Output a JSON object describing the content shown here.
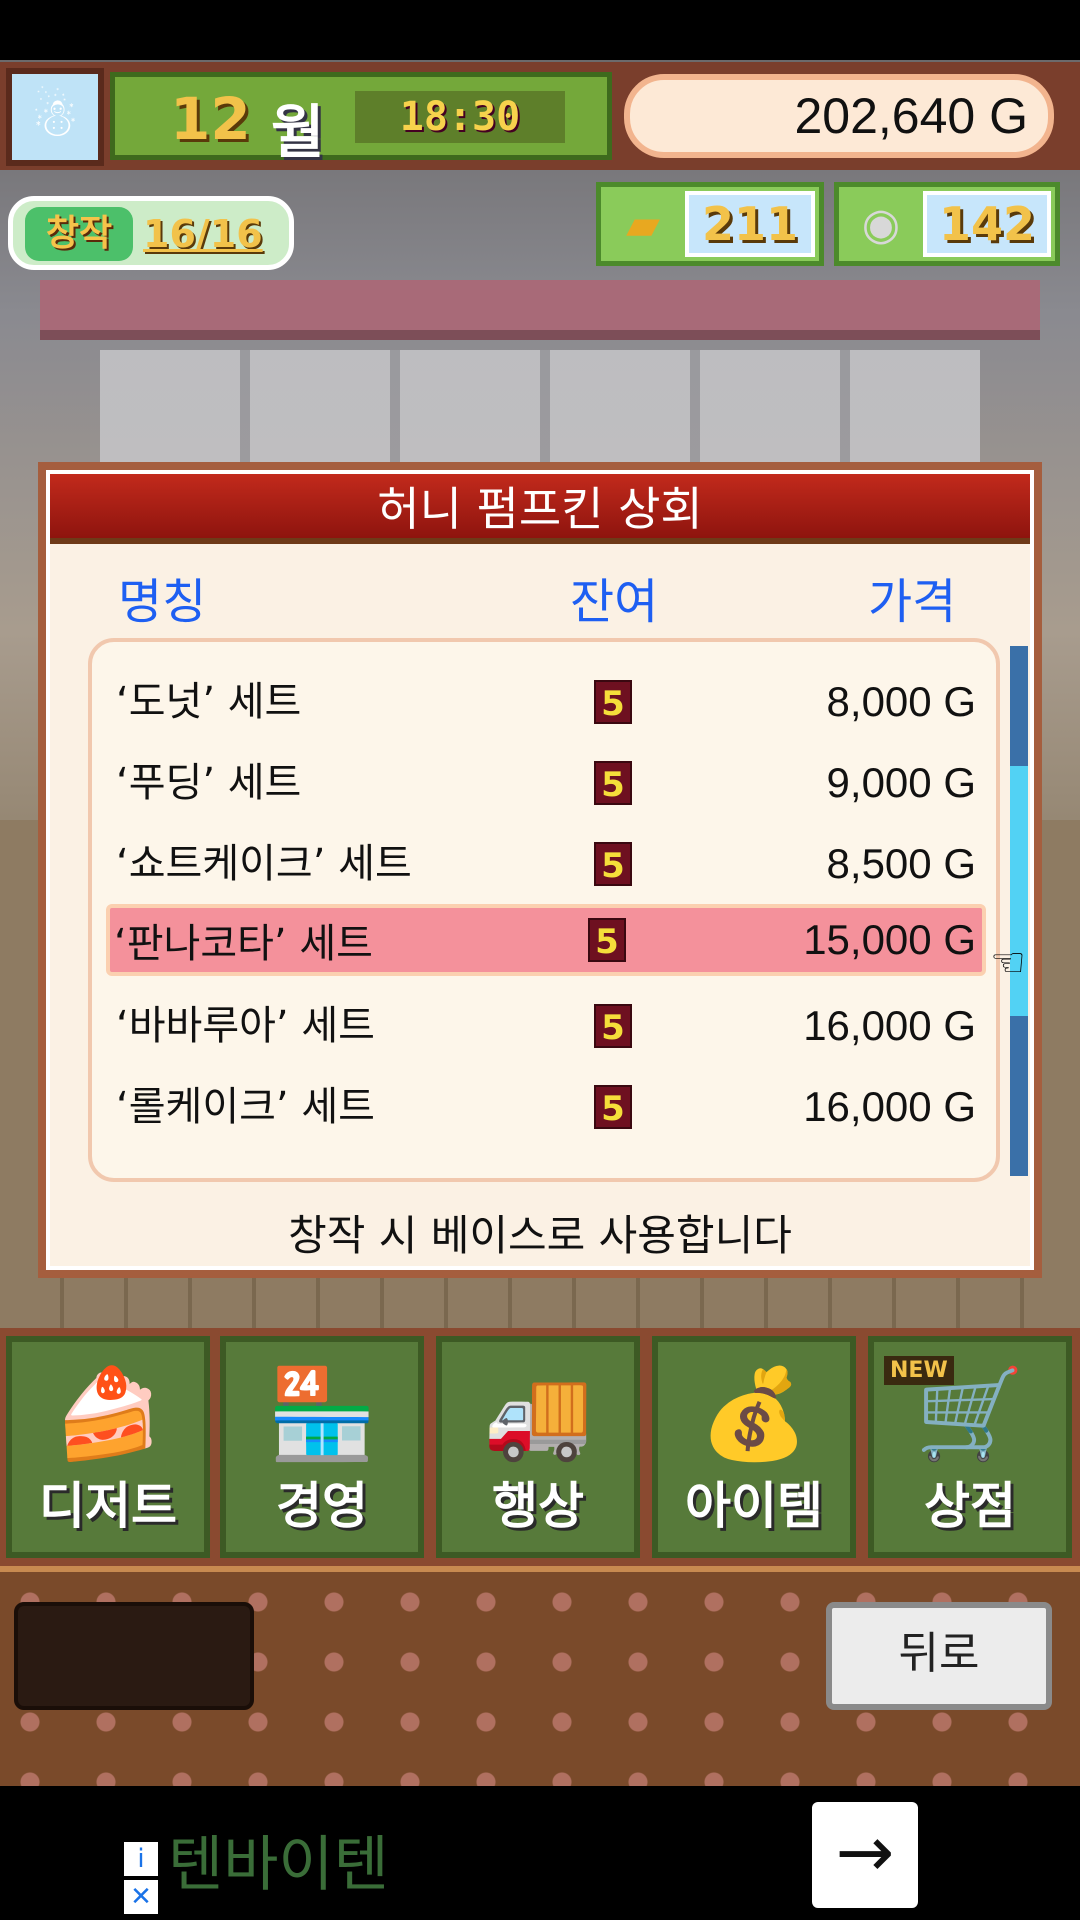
{
  "top": {
    "month_value": "12",
    "month_label": "월",
    "time": "18:30",
    "gold": "202,640 G"
  },
  "creation": {
    "label": "창작",
    "value": "16/16"
  },
  "currency": [
    {
      "icon": "ticket-icon",
      "value": "211"
    },
    {
      "icon": "medal-icon",
      "value": "142"
    }
  ],
  "dialog": {
    "title": "허니 펌프킨 상회",
    "col_name": "명칭",
    "col_stock": "잔여",
    "col_price": "가격",
    "items": [
      {
        "name": "‘도넛’ 세트",
        "stock": "5",
        "price": "8,000 G"
      },
      {
        "name": "‘푸딩’ 세트",
        "stock": "5",
        "price": "9,000 G"
      },
      {
        "name": "‘쇼트케이크’ 세트",
        "stock": "5",
        "price": "8,500 G"
      },
      {
        "name": "‘판나코타’ 세트",
        "stock": "5",
        "price": "15,000 G"
      },
      {
        "name": "‘바바루아’ 세트",
        "stock": "5",
        "price": "16,000 G"
      },
      {
        "name": "‘롤케이크’ 세트",
        "stock": "5",
        "price": "16,000 G"
      }
    ],
    "selected_index": 3,
    "footer": "창작 시 베이스로 사용합니다"
  },
  "menu": [
    {
      "label": "디저트",
      "icon": "cake-icon"
    },
    {
      "label": "경영",
      "icon": "shop-icon"
    },
    {
      "label": "행상",
      "icon": "food-truck-icon"
    },
    {
      "label": "아이템",
      "icon": "item-bag-icon"
    },
    {
      "label": "상점",
      "icon": "shopping-cart-icon",
      "badge": "NEW"
    }
  ],
  "back_label": "뒤로",
  "ad": {
    "text": "텐바이텐",
    "info": "i",
    "close": "✕",
    "arrow": "→"
  }
}
